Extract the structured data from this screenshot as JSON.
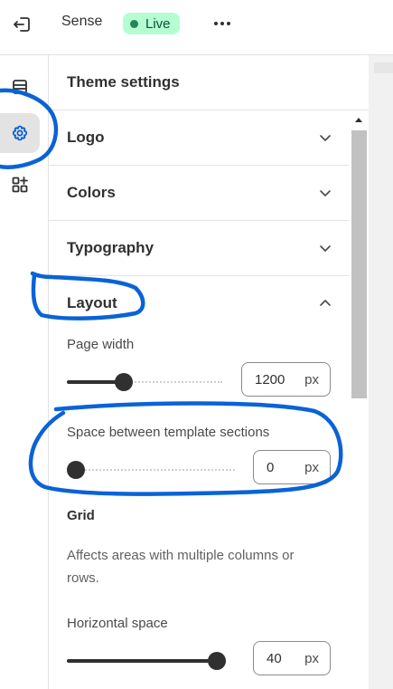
{
  "topbar": {
    "exit_icon": "exit-icon",
    "theme_name": "Sense",
    "live_label": "Live",
    "more_icon": "more-horizontal-icon"
  },
  "rail": {
    "items": [
      {
        "icon": "sections-icon",
        "active": false
      },
      {
        "icon": "gear-icon",
        "active": true
      },
      {
        "icon": "apps-add-icon",
        "active": false
      }
    ]
  },
  "panel": {
    "title": "Theme settings",
    "sections": [
      {
        "label": "Logo",
        "expanded": false
      },
      {
        "label": "Colors",
        "expanded": false
      },
      {
        "label": "Typography",
        "expanded": false
      },
      {
        "label": "Layout",
        "expanded": true
      }
    ],
    "layout": {
      "page_width": {
        "label": "Page width",
        "value": "1200",
        "unit": "px",
        "fraction": 0.35
      },
      "section_spacing": {
        "label": "Space between template sections",
        "value": "0",
        "unit": "px",
        "fraction": 0.0
      },
      "grid_heading": "Grid",
      "grid_help": "Affects areas with multiple columns or rows.",
      "horizontal_space": {
        "label": "Horizontal space",
        "value": "40",
        "unit": "px",
        "fraction": 1.0
      }
    }
  },
  "colors": {
    "accent_blue": "#005bd3",
    "annotation_blue": "#0a63d6",
    "live_bg": "#b4fed2",
    "live_dot": "#29845a"
  }
}
